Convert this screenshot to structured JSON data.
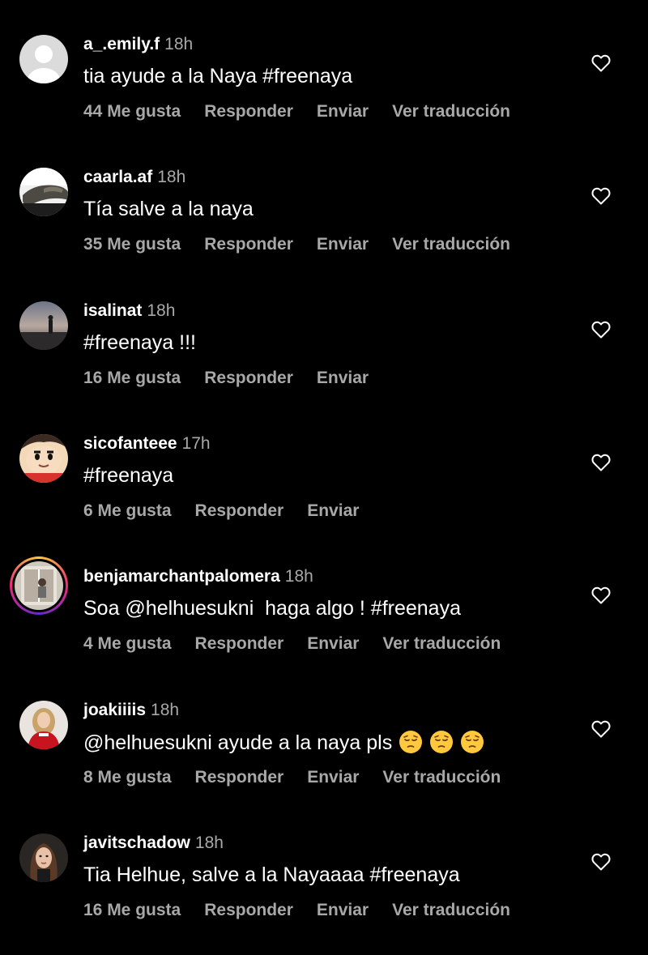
{
  "comments": [
    {
      "username": "a_.emily.f",
      "time": "18h",
      "text": "tia ayude a la Naya #freenaya",
      "likes": "44 Me gusta",
      "reply": "Responder",
      "send": "Enviar",
      "translate": "Ver traducción",
      "avatar": "default-avatar"
    },
    {
      "username": "caarla.af",
      "time": "18h",
      "text": "Tía salve a la naya",
      "likes": "35 Me gusta",
      "reply": "Responder",
      "send": "Enviar",
      "translate": "Ver traducción",
      "avatar": "photo-avatar"
    },
    {
      "username": "isalinat",
      "time": "18h",
      "text": "#freenaya !!!",
      "likes": "16 Me gusta",
      "reply": "Responder",
      "send": "Enviar",
      "avatar": "photo-avatar"
    },
    {
      "username": "sicofanteee",
      "time": "17h",
      "text": "#freenaya",
      "likes": "6 Me gusta",
      "reply": "Responder",
      "send": "Enviar",
      "avatar": "cartoon-avatar"
    },
    {
      "username": "benjamarchantpalomera",
      "time": "18h",
      "text": "Soa @helhuesukni  haga algo ! #freenaya",
      "likes": "4 Me gusta",
      "reply": "Responder",
      "send": "Enviar",
      "translate": "Ver traducción",
      "avatar": "story-ring-avatar"
    },
    {
      "username": "joakiiiis",
      "time": "18h",
      "text": "@helhuesukni ayude a la naya pls",
      "emojis": [
        "pensive-face-emoji",
        "pensive-face-emoji",
        "pensive-face-emoji"
      ],
      "likes": "8 Me gusta",
      "reply": "Responder",
      "send": "Enviar",
      "translate": "Ver traducción",
      "avatar": "photo-avatar"
    },
    {
      "username": "javitschadow",
      "time": "18h",
      "text": "Tia Helhue, salve a la Nayaaaa #freenaya",
      "likes": "16 Me gusta",
      "reply": "Responder",
      "send": "Enviar",
      "translate": "Ver traducción",
      "avatar": "photo-avatar"
    }
  ],
  "colors": {
    "background": "#000000",
    "primary_text": "#ffffff",
    "secondary_text": "#a8a8a8",
    "story_ring": [
      "#f9ce34",
      "#ee2a7b",
      "#6228d7"
    ]
  },
  "icons": {
    "like": "heart-outline-icon"
  }
}
